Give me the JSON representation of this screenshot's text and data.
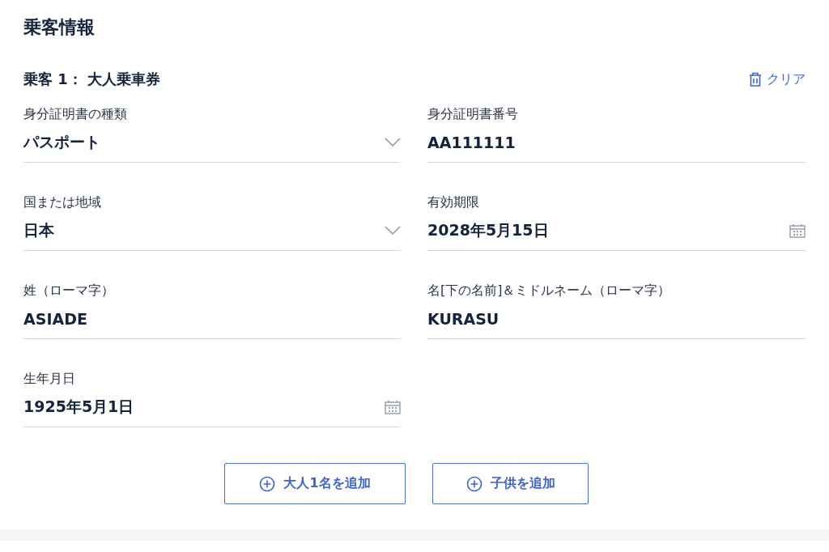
{
  "title": "乗客情報",
  "passenger": {
    "heading": "乗客 1： 大人乗車券",
    "clear": "クリア"
  },
  "fields": [
    {
      "kind": "select",
      "label": "身分証明書の種類",
      "value": "パスポート"
    },
    {
      "kind": "text",
      "label": "身分証明書番号",
      "value": "AA111111"
    },
    {
      "kind": "select",
      "label": "国または地域",
      "value": "日本"
    },
    {
      "kind": "date",
      "label": "有効期限",
      "value": "2028年5月15日"
    },
    {
      "kind": "text",
      "label": "姓（ローマ字）",
      "value": "ASIADE"
    },
    {
      "kind": "text",
      "label": "名[下の名前]＆ミドルネーム（ローマ字）",
      "value": "KURASU"
    },
    {
      "kind": "date",
      "label": "生年月日",
      "value": "1925年5月1日"
    }
  ],
  "buttons": [
    "大人1名を追加",
    "子供を追加"
  ]
}
